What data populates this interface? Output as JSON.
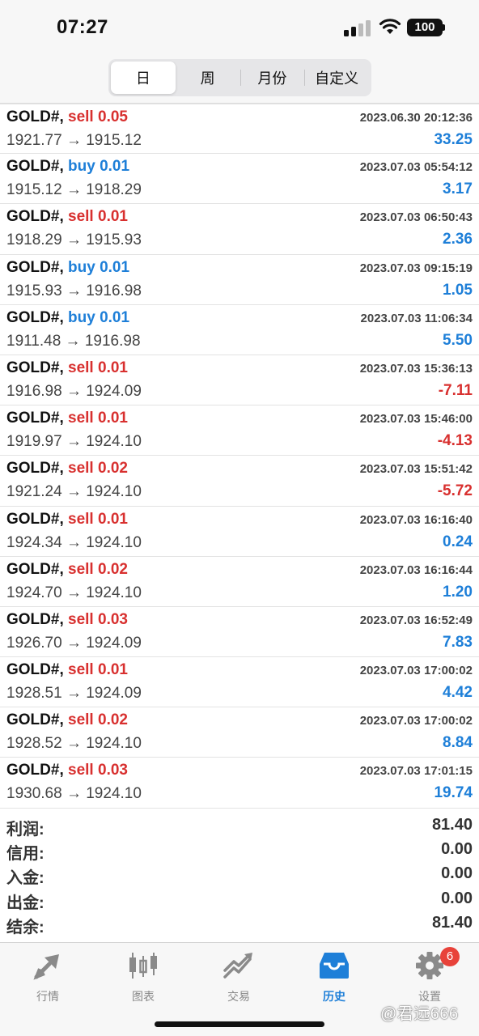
{
  "status": {
    "time": "07:27",
    "battery": "100"
  },
  "segments": [
    {
      "label": "日",
      "active": true
    },
    {
      "label": "周",
      "active": false
    },
    {
      "label": "月份",
      "active": false
    },
    {
      "label": "自定义",
      "active": false
    }
  ],
  "trades": [
    {
      "symbol": "GOLD#,",
      "side": "sell",
      "volume": "0.05",
      "prices": "1921.77 → 1915.12",
      "time": "2023.06.30 20:12:36",
      "profit": "33.25"
    },
    {
      "symbol": "GOLD#,",
      "side": "buy",
      "volume": "0.01",
      "prices": "1915.12 → 1918.29",
      "time": "2023.07.03 05:54:12",
      "profit": "3.17"
    },
    {
      "symbol": "GOLD#,",
      "side": "sell",
      "volume": "0.01",
      "prices": "1918.29 → 1915.93",
      "time": "2023.07.03 06:50:43",
      "profit": "2.36"
    },
    {
      "symbol": "GOLD#,",
      "side": "buy",
      "volume": "0.01",
      "prices": "1915.93 → 1916.98",
      "time": "2023.07.03 09:15:19",
      "profit": "1.05"
    },
    {
      "symbol": "GOLD#,",
      "side": "buy",
      "volume": "0.01",
      "prices": "1911.48 → 1916.98",
      "time": "2023.07.03 11:06:34",
      "profit": "5.50"
    },
    {
      "symbol": "GOLD#,",
      "side": "sell",
      "volume": "0.01",
      "prices": "1916.98 → 1924.09",
      "time": "2023.07.03 15:36:13",
      "profit": "-7.11"
    },
    {
      "symbol": "GOLD#,",
      "side": "sell",
      "volume": "0.01",
      "prices": "1919.97 → 1924.10",
      "time": "2023.07.03 15:46:00",
      "profit": "-4.13"
    },
    {
      "symbol": "GOLD#,",
      "side": "sell",
      "volume": "0.02",
      "prices": "1921.24 → 1924.10",
      "time": "2023.07.03 15:51:42",
      "profit": "-5.72"
    },
    {
      "symbol": "GOLD#,",
      "side": "sell",
      "volume": "0.01",
      "prices": "1924.34 → 1924.10",
      "time": "2023.07.03 16:16:40",
      "profit": "0.24"
    },
    {
      "symbol": "GOLD#,",
      "side": "sell",
      "volume": "0.02",
      "prices": "1924.70 → 1924.10",
      "time": "2023.07.03 16:16:44",
      "profit": "1.20"
    },
    {
      "symbol": "GOLD#,",
      "side": "sell",
      "volume": "0.03",
      "prices": "1926.70 → 1924.09",
      "time": "2023.07.03 16:52:49",
      "profit": "7.83"
    },
    {
      "symbol": "GOLD#,",
      "side": "sell",
      "volume": "0.01",
      "prices": "1928.51 → 1924.09",
      "time": "2023.07.03 17:00:02",
      "profit": "4.42"
    },
    {
      "symbol": "GOLD#,",
      "side": "sell",
      "volume": "0.02",
      "prices": "1928.52 → 1924.10",
      "time": "2023.07.03 17:00:02",
      "profit": "8.84"
    },
    {
      "symbol": "GOLD#,",
      "side": "sell",
      "volume": "0.03",
      "prices": "1930.68 → 1924.10",
      "time": "2023.07.03 17:01:15",
      "profit": "19.74"
    }
  ],
  "summary": [
    {
      "label": "利润:",
      "value": "81.40"
    },
    {
      "label": "信用:",
      "value": "0.00"
    },
    {
      "label": "入金:",
      "value": "0.00"
    },
    {
      "label": "出金:",
      "value": "0.00"
    },
    {
      "label": "结余:",
      "value": "81.40"
    }
  ],
  "tabs": [
    {
      "label": "行情",
      "icon": "quotes-arrows-icon",
      "active": false
    },
    {
      "label": "图表",
      "icon": "candlestick-chart-icon",
      "active": false
    },
    {
      "label": "交易",
      "icon": "trade-trend-icon",
      "active": false
    },
    {
      "label": "历史",
      "icon": "history-inbox-icon",
      "active": true
    },
    {
      "label": "设置",
      "icon": "settings-gear-icon",
      "active": false
    }
  ],
  "settings_badge": "6",
  "watermark": "@君远666",
  "colors": {
    "sell": "#d8302f",
    "buy": "#1e7fd8",
    "profit_positive": "#1e7fd8",
    "profit_negative": "#d8302f",
    "accent": "#1e7fd8"
  }
}
